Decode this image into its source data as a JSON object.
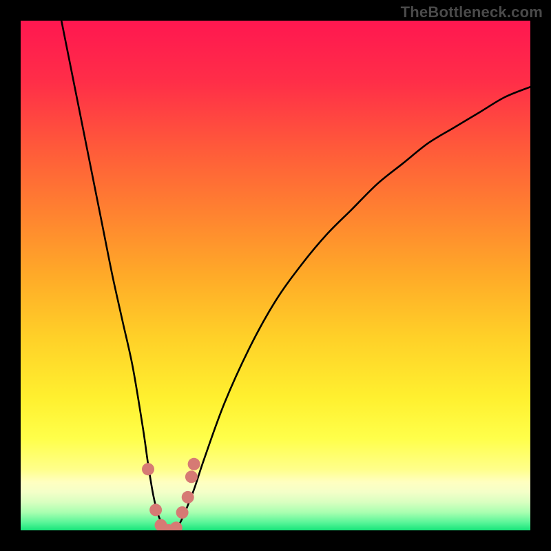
{
  "watermark": "TheBottleneck.com",
  "chart_data": {
    "type": "line",
    "title": "",
    "xlabel": "",
    "ylabel": "",
    "xlim": [
      0,
      100
    ],
    "ylim": [
      0,
      100
    ],
    "series": [
      {
        "name": "bottleneck-curve",
        "x": [
          8,
          10,
          12,
          14,
          16,
          18,
          20,
          22,
          24,
          25,
          26,
          27,
          28,
          29,
          30,
          31,
          32,
          34,
          36,
          40,
          45,
          50,
          55,
          60,
          65,
          70,
          75,
          80,
          85,
          90,
          95,
          100
        ],
        "values": [
          100,
          90,
          80,
          70,
          60,
          50,
          41,
          32,
          20,
          13,
          7,
          3,
          1,
          0,
          0,
          1,
          3,
          8,
          14,
          25,
          36,
          45,
          52,
          58,
          63,
          68,
          72,
          76,
          79,
          82,
          85,
          87
        ]
      }
    ],
    "markers": {
      "name": "trough-dots",
      "color": "#d67a74",
      "points": [
        {
          "x": 25.0,
          "y": 12
        },
        {
          "x": 26.5,
          "y": 4
        },
        {
          "x": 27.5,
          "y": 1
        },
        {
          "x": 29.0,
          "y": 0
        },
        {
          "x": 30.5,
          "y": 0.5
        },
        {
          "x": 31.7,
          "y": 3.5
        },
        {
          "x": 32.8,
          "y": 6.5
        },
        {
          "x": 33.5,
          "y": 10.5
        },
        {
          "x": 34.0,
          "y": 13.0
        }
      ]
    },
    "background_gradient": {
      "stops": [
        {
          "pos": 0.0,
          "color": "#ff1750"
        },
        {
          "pos": 0.12,
          "color": "#ff2e48"
        },
        {
          "pos": 0.25,
          "color": "#ff5a3a"
        },
        {
          "pos": 0.38,
          "color": "#ff8330"
        },
        {
          "pos": 0.5,
          "color": "#ffaa28"
        },
        {
          "pos": 0.62,
          "color": "#ffd028"
        },
        {
          "pos": 0.74,
          "color": "#fff02f"
        },
        {
          "pos": 0.82,
          "color": "#ffff4a"
        },
        {
          "pos": 0.88,
          "color": "#ffff8a"
        },
        {
          "pos": 0.905,
          "color": "#ffffc0"
        },
        {
          "pos": 0.925,
          "color": "#f4ffc8"
        },
        {
          "pos": 0.945,
          "color": "#d8ffc0"
        },
        {
          "pos": 0.965,
          "color": "#a8ffb0"
        },
        {
          "pos": 0.985,
          "color": "#58f598"
        },
        {
          "pos": 1.0,
          "color": "#17e57a"
        }
      ]
    }
  }
}
